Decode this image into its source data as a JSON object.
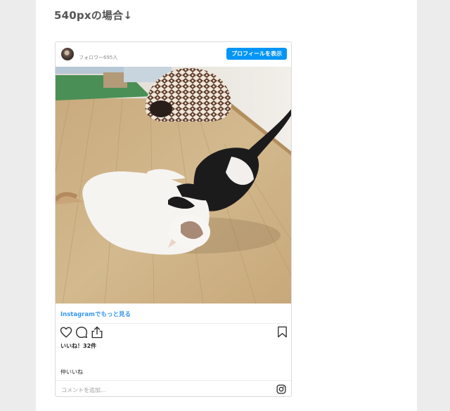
{
  "heading": "540pxの場合↓",
  "post": {
    "followers": "フォロワー695人",
    "profile_button": "プロフィールを表示",
    "more_link": "Instagramでもっと見る",
    "likes": "いいね！32件",
    "caption": "仲いいね",
    "comment_placeholder": "コメントを追加...",
    "icons": {
      "avatar": "avatar",
      "like": "heart-icon",
      "comment": "comment-icon",
      "share": "share-icon",
      "save": "bookmark-icon",
      "instagram": "instagram-icon"
    }
  },
  "colors": {
    "accent": "#0095f6",
    "link": "#3897f0",
    "page_bg": "#ececec"
  }
}
